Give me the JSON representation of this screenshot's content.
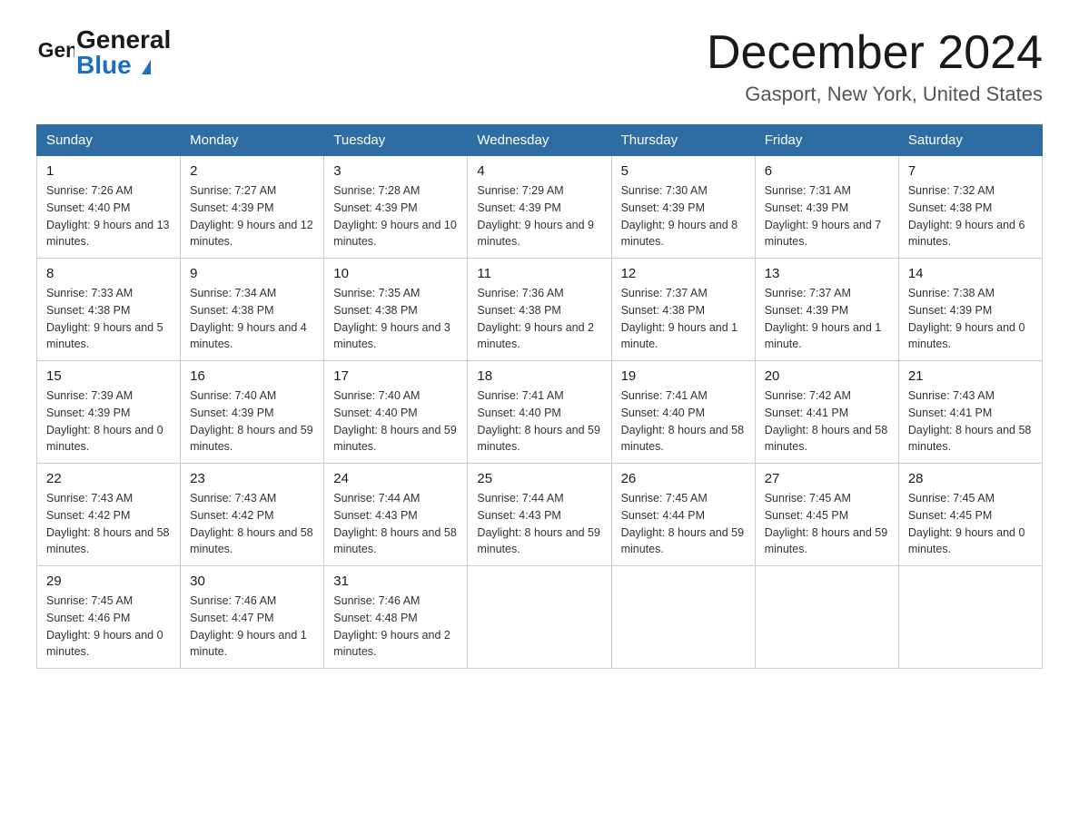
{
  "header": {
    "logo_line1": "General",
    "logo_line2": "Blue",
    "title": "December 2024",
    "subtitle": "Gasport, New York, United States"
  },
  "calendar": {
    "days_of_week": [
      "Sunday",
      "Monday",
      "Tuesday",
      "Wednesday",
      "Thursday",
      "Friday",
      "Saturday"
    ],
    "weeks": [
      [
        {
          "day": "1",
          "sunrise": "7:26 AM",
          "sunset": "4:40 PM",
          "daylight": "9 hours and 13 minutes."
        },
        {
          "day": "2",
          "sunrise": "7:27 AM",
          "sunset": "4:39 PM",
          "daylight": "9 hours and 12 minutes."
        },
        {
          "day": "3",
          "sunrise": "7:28 AM",
          "sunset": "4:39 PM",
          "daylight": "9 hours and 10 minutes."
        },
        {
          "day": "4",
          "sunrise": "7:29 AM",
          "sunset": "4:39 PM",
          "daylight": "9 hours and 9 minutes."
        },
        {
          "day": "5",
          "sunrise": "7:30 AM",
          "sunset": "4:39 PM",
          "daylight": "9 hours and 8 minutes."
        },
        {
          "day": "6",
          "sunrise": "7:31 AM",
          "sunset": "4:39 PM",
          "daylight": "9 hours and 7 minutes."
        },
        {
          "day": "7",
          "sunrise": "7:32 AM",
          "sunset": "4:38 PM",
          "daylight": "9 hours and 6 minutes."
        }
      ],
      [
        {
          "day": "8",
          "sunrise": "7:33 AM",
          "sunset": "4:38 PM",
          "daylight": "9 hours and 5 minutes."
        },
        {
          "day": "9",
          "sunrise": "7:34 AM",
          "sunset": "4:38 PM",
          "daylight": "9 hours and 4 minutes."
        },
        {
          "day": "10",
          "sunrise": "7:35 AM",
          "sunset": "4:38 PM",
          "daylight": "9 hours and 3 minutes."
        },
        {
          "day": "11",
          "sunrise": "7:36 AM",
          "sunset": "4:38 PM",
          "daylight": "9 hours and 2 minutes."
        },
        {
          "day": "12",
          "sunrise": "7:37 AM",
          "sunset": "4:38 PM",
          "daylight": "9 hours and 1 minute."
        },
        {
          "day": "13",
          "sunrise": "7:37 AM",
          "sunset": "4:39 PM",
          "daylight": "9 hours and 1 minute."
        },
        {
          "day": "14",
          "sunrise": "7:38 AM",
          "sunset": "4:39 PM",
          "daylight": "9 hours and 0 minutes."
        }
      ],
      [
        {
          "day": "15",
          "sunrise": "7:39 AM",
          "sunset": "4:39 PM",
          "daylight": "8 hours and 0 minutes."
        },
        {
          "day": "16",
          "sunrise": "7:40 AM",
          "sunset": "4:39 PM",
          "daylight": "8 hours and 59 minutes."
        },
        {
          "day": "17",
          "sunrise": "7:40 AM",
          "sunset": "4:40 PM",
          "daylight": "8 hours and 59 minutes."
        },
        {
          "day": "18",
          "sunrise": "7:41 AM",
          "sunset": "4:40 PM",
          "daylight": "8 hours and 59 minutes."
        },
        {
          "day": "19",
          "sunrise": "7:41 AM",
          "sunset": "4:40 PM",
          "daylight": "8 hours and 58 minutes."
        },
        {
          "day": "20",
          "sunrise": "7:42 AM",
          "sunset": "4:41 PM",
          "daylight": "8 hours and 58 minutes."
        },
        {
          "day": "21",
          "sunrise": "7:43 AM",
          "sunset": "4:41 PM",
          "daylight": "8 hours and 58 minutes."
        }
      ],
      [
        {
          "day": "22",
          "sunrise": "7:43 AM",
          "sunset": "4:42 PM",
          "daylight": "8 hours and 58 minutes."
        },
        {
          "day": "23",
          "sunrise": "7:43 AM",
          "sunset": "4:42 PM",
          "daylight": "8 hours and 58 minutes."
        },
        {
          "day": "24",
          "sunrise": "7:44 AM",
          "sunset": "4:43 PM",
          "daylight": "8 hours and 58 minutes."
        },
        {
          "day": "25",
          "sunrise": "7:44 AM",
          "sunset": "4:43 PM",
          "daylight": "8 hours and 59 minutes."
        },
        {
          "day": "26",
          "sunrise": "7:45 AM",
          "sunset": "4:44 PM",
          "daylight": "8 hours and 59 minutes."
        },
        {
          "day": "27",
          "sunrise": "7:45 AM",
          "sunset": "4:45 PM",
          "daylight": "8 hours and 59 minutes."
        },
        {
          "day": "28",
          "sunrise": "7:45 AM",
          "sunset": "4:45 PM",
          "daylight": "9 hours and 0 minutes."
        }
      ],
      [
        {
          "day": "29",
          "sunrise": "7:45 AM",
          "sunset": "4:46 PM",
          "daylight": "9 hours and 0 minutes."
        },
        {
          "day": "30",
          "sunrise": "7:46 AM",
          "sunset": "4:47 PM",
          "daylight": "9 hours and 1 minute."
        },
        {
          "day": "31",
          "sunrise": "7:46 AM",
          "sunset": "4:48 PM",
          "daylight": "9 hours and 2 minutes."
        },
        null,
        null,
        null,
        null
      ]
    ]
  }
}
